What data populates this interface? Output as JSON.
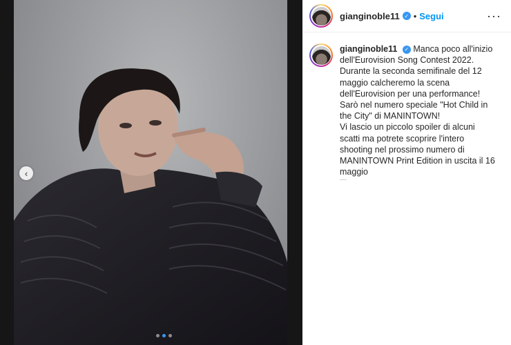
{
  "post": {
    "username": "gianginoble11",
    "follow_label": "Segui",
    "dot": "•",
    "more_label": "···",
    "caption_lines": [
      "Manca poco all'inizio dell'Eurovision Song Contest 2022.",
      "Durante la seconda semifinale del 12 maggio calcheremo la scena dell'Eurovision per una performance!",
      "Sarò nel numero speciale \"Hot Child in the City\" di MANINTOWN!",
      "Vi lascio un piccolo spoiler di alcuni scatti ma potrete scoprire l'intero shooting nel prossimo numero di MANINTOWN Print Edition in uscita il 16 maggio"
    ],
    "caption_more": "—",
    "carousel": {
      "prev_icon": "‹",
      "slides": 3,
      "active": 1
    }
  },
  "colors": {
    "link": "#0095f6",
    "verified": "#3897f0",
    "text": "#262626"
  }
}
